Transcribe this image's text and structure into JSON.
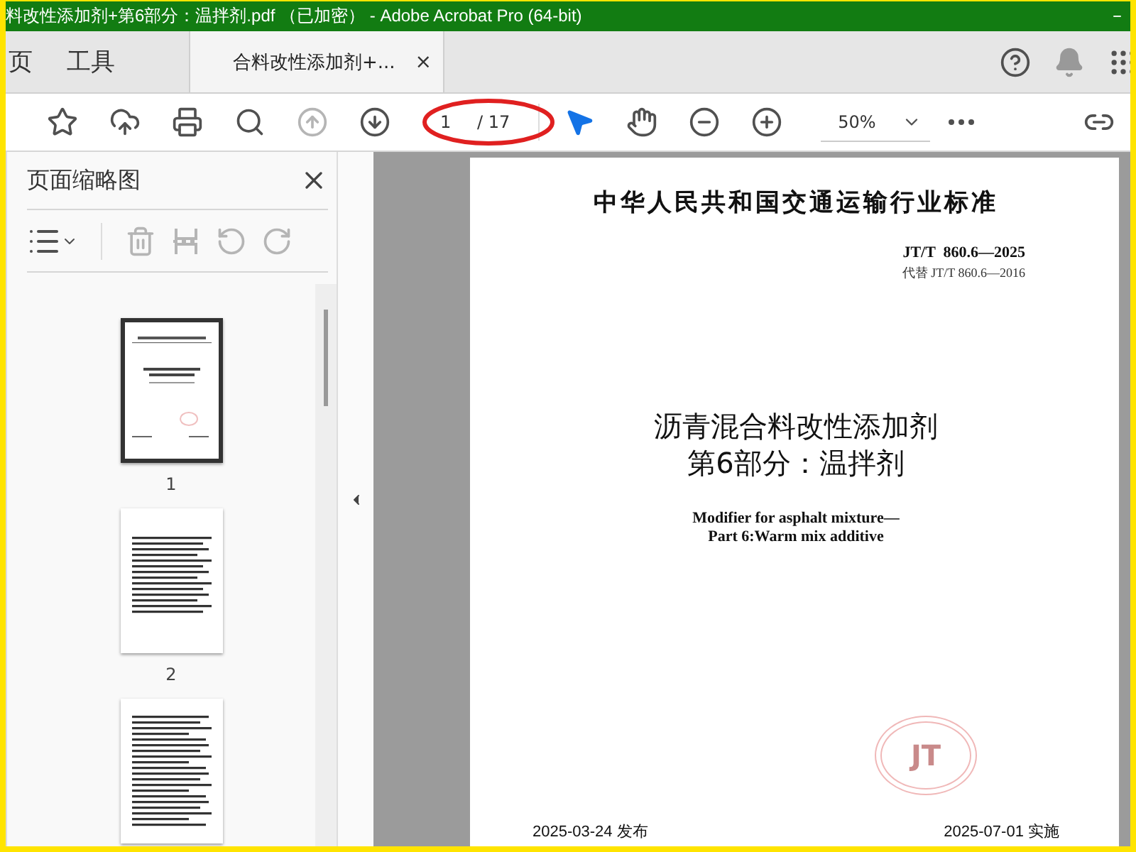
{
  "window": {
    "title": "料改性添加剂+第6部分：温拌剂.pdf （已加密） - Adobe Acrobat Pro (64-bit)",
    "control": "–"
  },
  "tabs": [
    {
      "label": "页",
      "selected": false,
      "kind": "nav"
    },
    {
      "label": "工具",
      "selected": false,
      "kind": "nav"
    },
    {
      "label": "合料改性添加剂+...",
      "selected": true,
      "kind": "document",
      "close": "×"
    }
  ],
  "toolbar": {
    "nav_buttons": [
      {
        "kind": "up",
        "disabled": true
      },
      {
        "kind": "down",
        "disabled": false
      }
    ],
    "page_field": {
      "value": "1"
    },
    "page_count": "/ 17",
    "tools": [
      {
        "kind": "pointer",
        "selected": true
      },
      {
        "kind": "hand",
        "selected": false
      }
    ],
    "zoom": {
      "value": "50%"
    }
  },
  "thumbnail_panel": {
    "title": "页面缩略图",
    "actions": [
      {
        "kind": "trash",
        "disabled": true
      },
      {
        "kind": "extract",
        "disabled": true
      },
      {
        "kind": "rotate-left",
        "disabled": true
      },
      {
        "kind": "rotate-right",
        "disabled": true
      }
    ],
    "thumbnails": [
      {
        "kind": "cover",
        "label": "1",
        "selected": true
      },
      {
        "kind": "contents",
        "label": "2",
        "selected": false
      },
      {
        "kind": "text",
        "selected": false
      }
    ]
  },
  "document": {
    "header": "中华人民共和国交通运输行业标准",
    "code": "JT/T  860.6—2025",
    "replaces": "代替 JT/T 860.6—2016",
    "title_lines": [
      "沥青混合料改性添加剂",
      "第6部分：温拌剂"
    ],
    "english_lines": [
      "Modifier for asphalt mixture—",
      "Part 6:Warm mix additive"
    ],
    "stamp": "JT",
    "issue_date": "2025-03-24 发布",
    "effective_date": "2025-07-01 实施"
  }
}
